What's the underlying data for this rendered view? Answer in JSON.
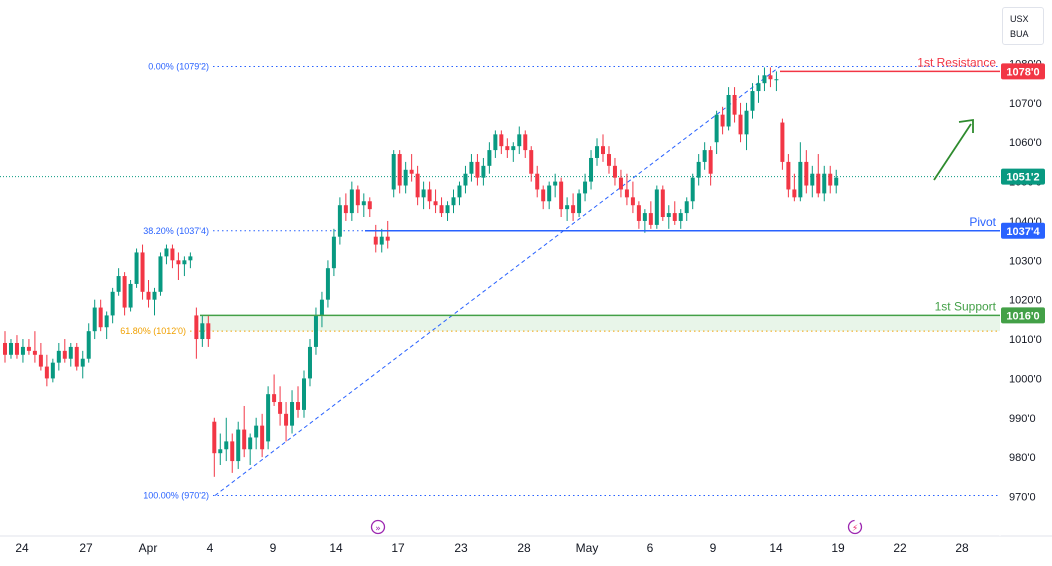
{
  "currency_selector": {
    "line1": "USX",
    "line2": "BUA"
  },
  "colors": {
    "up": "#089981",
    "down": "#f23645",
    "resistance": "#f23645",
    "pivot": "#2962ff",
    "support": "#43a047",
    "support_zone": "#e8f5e9",
    "fib": "#2962ff",
    "fib_61": "#f0a000",
    "last_price": "#089981",
    "arrow": "#2e8b2e"
  },
  "icons": [
    "event-icon",
    "lightning-icon",
    "arrow-up-right-icon"
  ],
  "chart_data": {
    "type": "candlestick",
    "y_axis": {
      "ylim": [
        966,
        1082
      ],
      "ticks": [
        970,
        980,
        990,
        1000,
        1010,
        1020,
        1030,
        1040,
        1050,
        1060,
        1070,
        1080
      ],
      "tick_labels": [
        "970'0",
        "980'0",
        "990'0",
        "1000'0",
        "1010'0",
        "1020'0",
        "1030'0",
        "1040'0",
        "1050'0",
        "1060'0",
        "1070'0",
        "1080'0"
      ]
    },
    "x_axis": {
      "labels": [
        "24",
        "27",
        "Apr",
        "4",
        "9",
        "14",
        "17",
        "23",
        "28",
        "May",
        "6",
        "9",
        "14",
        "19",
        "22",
        "28"
      ]
    },
    "last_price": {
      "value": 1051.25,
      "label": "1051'2"
    },
    "levels": [
      {
        "name": "1st Resistance",
        "value": 1078.0,
        "tag": "1078'0"
      },
      {
        "name": "Pivot",
        "value": 1037.5,
        "tag": "1037'4"
      },
      {
        "name": "1st Support",
        "value": 1016.0,
        "tag": "1016'0"
      }
    ],
    "fib_levels": [
      {
        "label": "0.00% (1079'2)",
        "value": 1079.25
      },
      {
        "label": "38.20% (1037'4)",
        "value": 1037.5
      },
      {
        "label": "61.80% (1012'0)",
        "value": 1012.0
      },
      {
        "label": "100.00% (970'2)",
        "value": 970.25
      }
    ],
    "candles": [
      [
        1009,
        1012,
        1004,
        1006
      ],
      [
        1006,
        1010,
        1005,
        1009
      ],
      [
        1009,
        1011,
        1005,
        1006
      ],
      [
        1006,
        1010,
        1004,
        1008
      ],
      [
        1008,
        1010,
        1006,
        1007
      ],
      [
        1007,
        1012,
        1004,
        1006
      ],
      [
        1006,
        1009,
        1002,
        1003
      ],
      [
        1003,
        1006,
        998,
        1000
      ],
      [
        1000,
        1005,
        999,
        1004
      ],
      [
        1004,
        1009,
        1002,
        1007
      ],
      [
        1007,
        1010,
        1004,
        1005
      ],
      [
        1005,
        1009,
        1003,
        1008
      ],
      [
        1008,
        1009,
        1002,
        1003
      ],
      [
        1003,
        1007,
        1000,
        1005
      ],
      [
        1005,
        1014,
        1004,
        1012
      ],
      [
        1012,
        1020,
        1010,
        1018
      ],
      [
        1018,
        1020,
        1012,
        1013
      ],
      [
        1013,
        1017,
        1010,
        1016
      ],
      [
        1016,
        1023,
        1014,
        1022
      ],
      [
        1022,
        1028,
        1021,
        1026
      ],
      [
        1026,
        1027,
        1016,
        1018
      ],
      [
        1018,
        1025,
        1017,
        1024
      ],
      [
        1024,
        1033,
        1023,
        1032
      ],
      [
        1032,
        1034,
        1020,
        1022
      ],
      [
        1022,
        1025,
        1018,
        1020
      ],
      [
        1020,
        1023,
        1016,
        1022
      ],
      [
        1022,
        1032,
        1021,
        1031
      ],
      [
        1031,
        1034,
        1029,
        1033
      ],
      [
        1033,
        1034,
        1028,
        1030
      ],
      [
        1030,
        1032,
        1025,
        1029
      ],
      [
        1029,
        1031,
        1026,
        1030
      ],
      [
        1030,
        1032,
        1028,
        1031
      ],
      [
        1016,
        1018,
        1005,
        1010
      ],
      [
        1010,
        1016,
        1008,
        1014
      ],
      [
        1014,
        1016,
        1008,
        1010
      ],
      [
        989,
        990,
        975,
        981
      ],
      [
        981,
        986,
        978,
        982
      ],
      [
        982,
        990,
        979,
        984
      ],
      [
        984,
        986,
        976,
        979
      ],
      [
        979,
        989,
        977,
        987
      ],
      [
        987,
        993,
        980,
        982
      ],
      [
        982,
        986,
        978,
        985
      ],
      [
        985,
        990,
        982,
        988
      ],
      [
        988,
        991,
        980,
        982
      ],
      [
        984,
        998,
        982,
        996
      ],
      [
        996,
        1001,
        993,
        994
      ],
      [
        994,
        998,
        988,
        991
      ],
      [
        991,
        994,
        984,
        988
      ],
      [
        988,
        997,
        986,
        994
      ],
      [
        994,
        998,
        990,
        992
      ],
      [
        992,
        1002,
        990,
        1000
      ],
      [
        1000,
        1010,
        998,
        1008
      ],
      [
        1008,
        1018,
        1006,
        1016
      ],
      [
        1016,
        1022,
        1013,
        1020
      ],
      [
        1020,
        1030,
        1018,
        1028
      ],
      [
        1028,
        1038,
        1026,
        1036
      ],
      [
        1036,
        1046,
        1034,
        1044
      ],
      [
        1044,
        1047,
        1040,
        1042
      ],
      [
        1042,
        1050,
        1040,
        1048
      ],
      [
        1048,
        1049,
        1042,
        1044
      ],
      [
        1044,
        1047,
        1041,
        1045
      ],
      [
        1045,
        1046,
        1041,
        1043
      ],
      [
        1036,
        1039,
        1032,
        1034
      ],
      [
        1034,
        1038,
        1032,
        1036
      ],
      [
        1036,
        1040,
        1033,
        1035
      ],
      [
        1048,
        1058,
        1046,
        1057
      ],
      [
        1057,
        1058,
        1047,
        1049
      ],
      [
        1049,
        1055,
        1047,
        1053
      ],
      [
        1053,
        1057,
        1050,
        1052
      ],
      [
        1052,
        1054,
        1044,
        1046
      ],
      [
        1046,
        1050,
        1043,
        1048
      ],
      [
        1048,
        1050,
        1043,
        1045
      ],
      [
        1045,
        1048,
        1042,
        1044
      ],
      [
        1044,
        1046,
        1041,
        1042
      ],
      [
        1042,
        1045,
        1040,
        1044
      ],
      [
        1044,
        1048,
        1042,
        1046
      ],
      [
        1046,
        1050,
        1044,
        1049
      ],
      [
        1049,
        1054,
        1047,
        1052
      ],
      [
        1052,
        1057,
        1050,
        1055
      ],
      [
        1055,
        1057,
        1049,
        1051
      ],
      [
        1051,
        1056,
        1049,
        1054
      ],
      [
        1054,
        1060,
        1052,
        1058
      ],
      [
        1058,
        1063,
        1056,
        1062
      ],
      [
        1062,
        1063,
        1057,
        1059
      ],
      [
        1059,
        1061,
        1056,
        1058
      ],
      [
        1058,
        1060,
        1055,
        1059
      ],
      [
        1059,
        1064,
        1057,
        1062
      ],
      [
        1062,
        1063,
        1056,
        1058
      ],
      [
        1058,
        1059,
        1050,
        1052
      ],
      [
        1052,
        1054,
        1046,
        1048
      ],
      [
        1048,
        1049,
        1043,
        1045
      ],
      [
        1045,
        1050,
        1043,
        1049
      ],
      [
        1049,
        1052,
        1046,
        1050
      ],
      [
        1050,
        1051,
        1041,
        1043
      ],
      [
        1043,
        1046,
        1040,
        1044
      ],
      [
        1044,
        1047,
        1040,
        1042
      ],
      [
        1042,
        1048,
        1041,
        1047
      ],
      [
        1047,
        1052,
        1045,
        1050
      ],
      [
        1050,
        1058,
        1048,
        1056
      ],
      [
        1056,
        1061,
        1054,
        1059
      ],
      [
        1059,
        1062,
        1055,
        1057
      ],
      [
        1057,
        1059,
        1052,
        1054
      ],
      [
        1054,
        1056,
        1049,
        1051
      ],
      [
        1051,
        1053,
        1046,
        1048
      ],
      [
        1048,
        1052,
        1044,
        1046
      ],
      [
        1046,
        1050,
        1042,
        1044
      ],
      [
        1044,
        1045,
        1038,
        1040
      ],
      [
        1040,
        1043,
        1037,
        1042
      ],
      [
        1042,
        1045,
        1038,
        1039
      ],
      [
        1039,
        1049,
        1038,
        1048
      ],
      [
        1048,
        1049,
        1040,
        1041
      ],
      [
        1041,
        1044,
        1038,
        1042
      ],
      [
        1042,
        1045,
        1039,
        1040
      ],
      [
        1040,
        1043,
        1038,
        1042
      ],
      [
        1042,
        1046,
        1040,
        1045
      ],
      [
        1045,
        1052,
        1043,
        1051
      ],
      [
        1051,
        1057,
        1049,
        1055
      ],
      [
        1055,
        1060,
        1053,
        1058
      ],
      [
        1058,
        1059,
        1049,
        1052
      ],
      [
        1060,
        1068,
        1057,
        1067
      ],
      [
        1067,
        1069,
        1062,
        1064
      ],
      [
        1064,
        1074,
        1063,
        1072
      ],
      [
        1072,
        1074,
        1065,
        1067
      ],
      [
        1067,
        1070,
        1060,
        1062
      ],
      [
        1062,
        1070,
        1058,
        1068
      ],
      [
        1068,
        1075,
        1066,
        1073
      ],
      [
        1073,
        1077,
        1070,
        1075
      ],
      [
        1075,
        1079,
        1073,
        1077
      ],
      [
        1077,
        1079,
        1074,
        1076
      ],
      [
        1076,
        1078,
        1073,
        1076
      ],
      [
        1065,
        1066,
        1053,
        1055
      ],
      [
        1055,
        1057,
        1046,
        1048
      ],
      [
        1048,
        1052,
        1045,
        1046
      ],
      [
        1046,
        1060,
        1045,
        1055
      ],
      [
        1055,
        1058,
        1047,
        1049
      ],
      [
        1049,
        1054,
        1046,
        1052
      ],
      [
        1052,
        1057,
        1046,
        1047
      ],
      [
        1047,
        1054,
        1045,
        1052
      ],
      [
        1052,
        1054,
        1047,
        1049
      ],
      [
        1049,
        1053,
        1047,
        1051
      ]
    ]
  }
}
